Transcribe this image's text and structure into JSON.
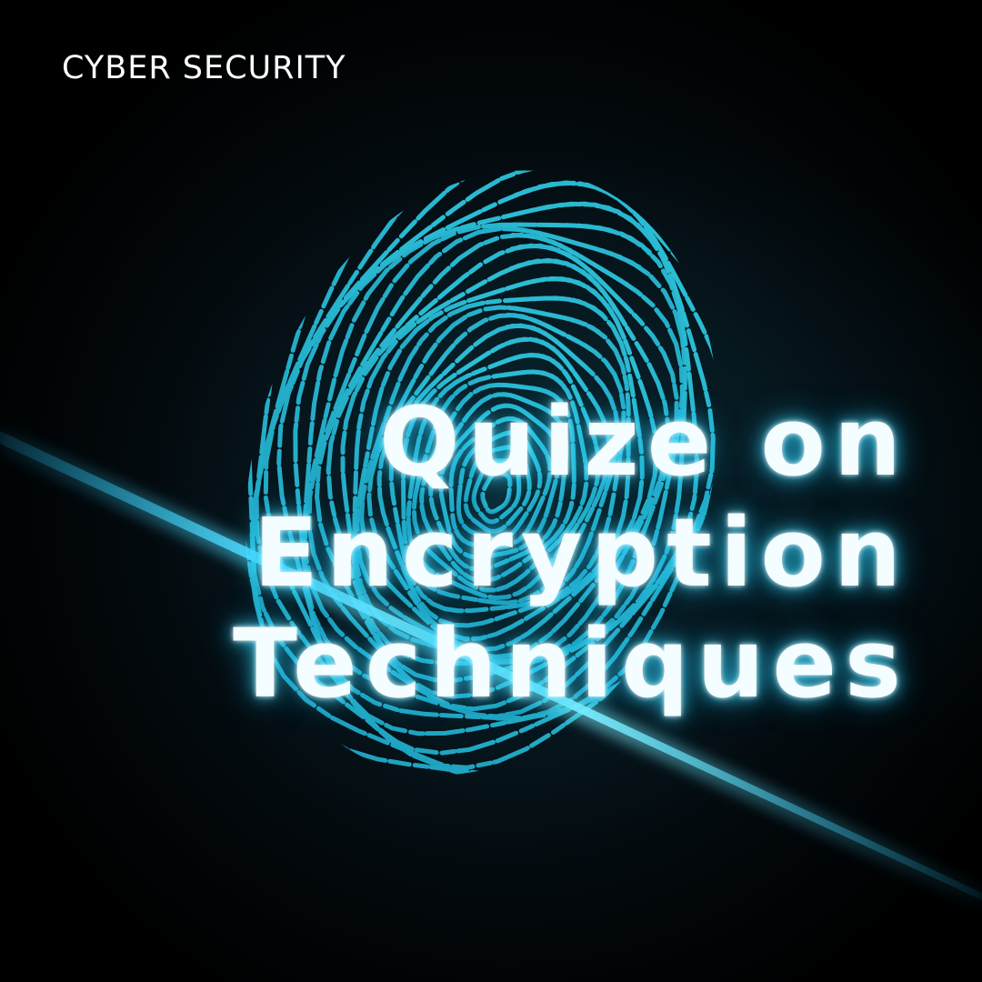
{
  "category_label": "CYBER SECURITY",
  "title_lines": [
    "Quize on",
    "Encryption",
    "Techniques"
  ],
  "colors": {
    "background": "#000000",
    "fingerprint": "#2ec8e0",
    "glow": "#3cdcff",
    "text": "#ffffff"
  },
  "icons": {
    "background_graphic": "fingerprint-icon",
    "accent": "light-streak"
  }
}
